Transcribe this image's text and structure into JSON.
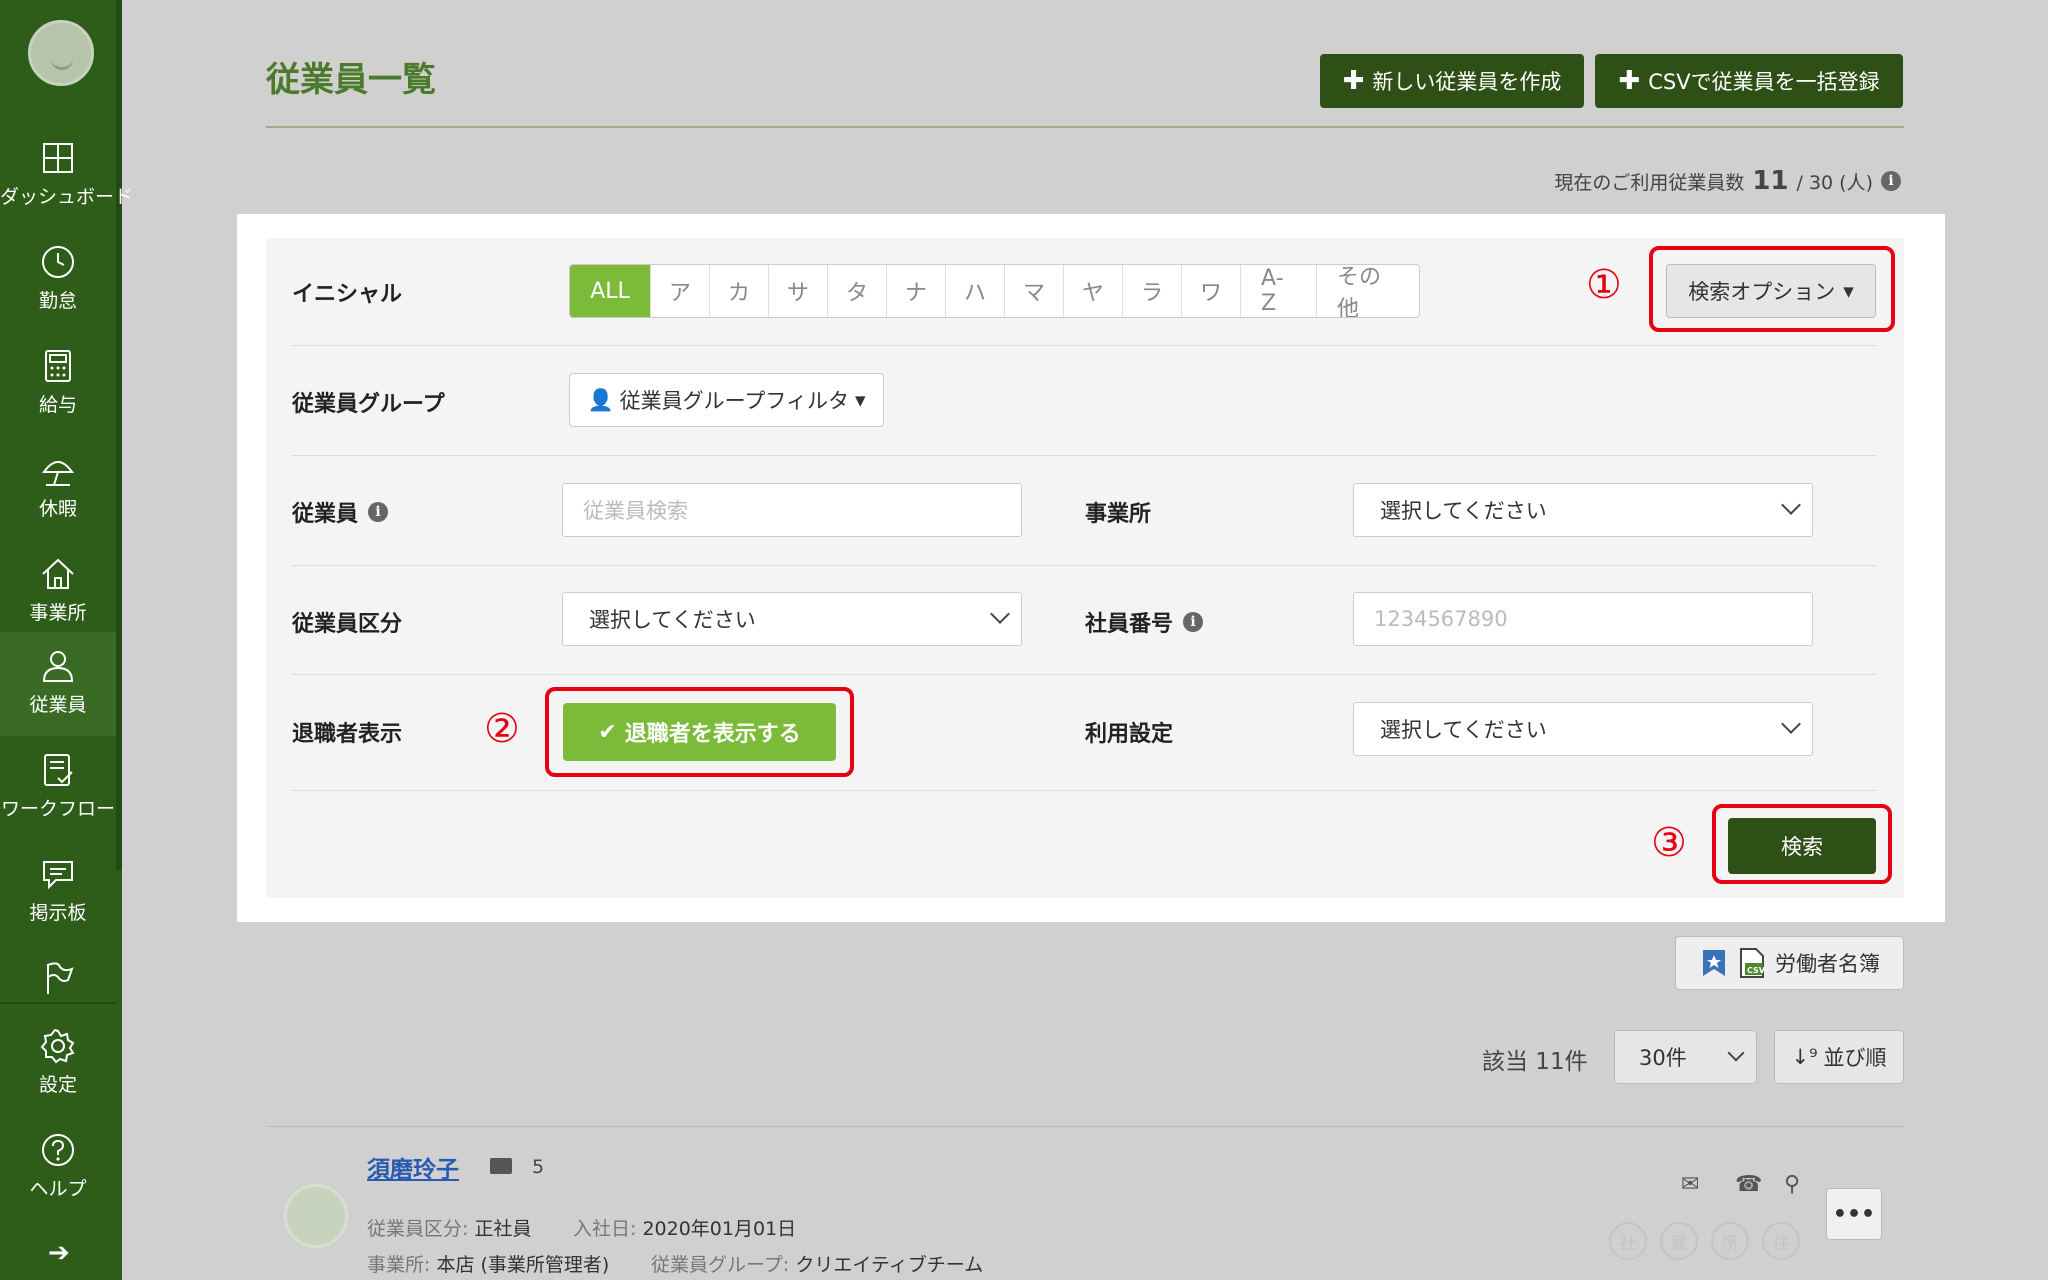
{
  "sidebar": {
    "items": [
      {
        "label": "ダッシュボード",
        "icon": "dashboard-icon"
      },
      {
        "label": "勤怠",
        "icon": "clock-icon"
      },
      {
        "label": "給与",
        "icon": "calculator-icon"
      },
      {
        "label": "休暇",
        "icon": "umbrella-icon"
      },
      {
        "label": "事業所",
        "icon": "home-icon"
      },
      {
        "label": "従業員",
        "icon": "user-icon"
      },
      {
        "label": "ワークフロー",
        "icon": "checklist-icon"
      },
      {
        "label": "掲示板",
        "icon": "chat-icon"
      },
      {
        "label": "",
        "icon": "flag-icon"
      },
      {
        "label": "設定",
        "icon": "gear-icon"
      },
      {
        "label": "ヘルプ",
        "icon": "help-icon"
      }
    ]
  },
  "header": {
    "title": "従業員一覧",
    "new_employee_label": "新しい従業員を作成",
    "csv_register_label": "CSVで従業員を一括登録"
  },
  "usage": {
    "label": "現在のご利用従業員数",
    "current": "11",
    "limit": "/ 30 (人)"
  },
  "search": {
    "initial_label": "イニシャル",
    "initials": [
      "ALL",
      "ア",
      "カ",
      "サ",
      "タ",
      "ナ",
      "ハ",
      "マ",
      "ヤ",
      "ラ",
      "ワ",
      "A-Z",
      "その他"
    ],
    "search_options_label": "検索オプション",
    "group_label": "従業員グループ",
    "group_filter_label": "従業員グループフィルタ",
    "employee_label": "従業員",
    "employee_placeholder": "従業員検索",
    "office_label": "事業所",
    "office_value": "選択してください",
    "category_label": "従業員区分",
    "category_value": "選択してください",
    "staff_no_label": "社員番号",
    "staff_no_placeholder": "1234567890",
    "retired_label": "退職者表示",
    "retired_button": "退職者を表示する",
    "usage_setting_label": "利用設定",
    "usage_setting_value": "選択してください",
    "search_button": "検索"
  },
  "annotations": {
    "n1": "①",
    "n2": "②",
    "n3": "③",
    "color": "#e60012"
  },
  "list": {
    "roster_label": "労働者名簿",
    "count_text": "該当 11件",
    "per_page": "30件",
    "sort_label": "並び順"
  },
  "employee": {
    "name": "須磨玲子",
    "number": "5",
    "category_key": "従業員区分:",
    "category_val": "正社員",
    "join_key": "入社日:",
    "join_val": "2020年01月01日",
    "office_key": "事業所:",
    "office_val": "本店 (事業所管理者)",
    "group_key": "従業員グループ:",
    "group_val": "クリエイティブチーム",
    "badges": [
      "社",
      "雇",
      "所",
      "住"
    ],
    "more_label": "•••"
  },
  "colors": {
    "brand_dark": "#2e5016",
    "brand_light": "#7cbb3a",
    "sidebar": "#2e5d1a"
  }
}
